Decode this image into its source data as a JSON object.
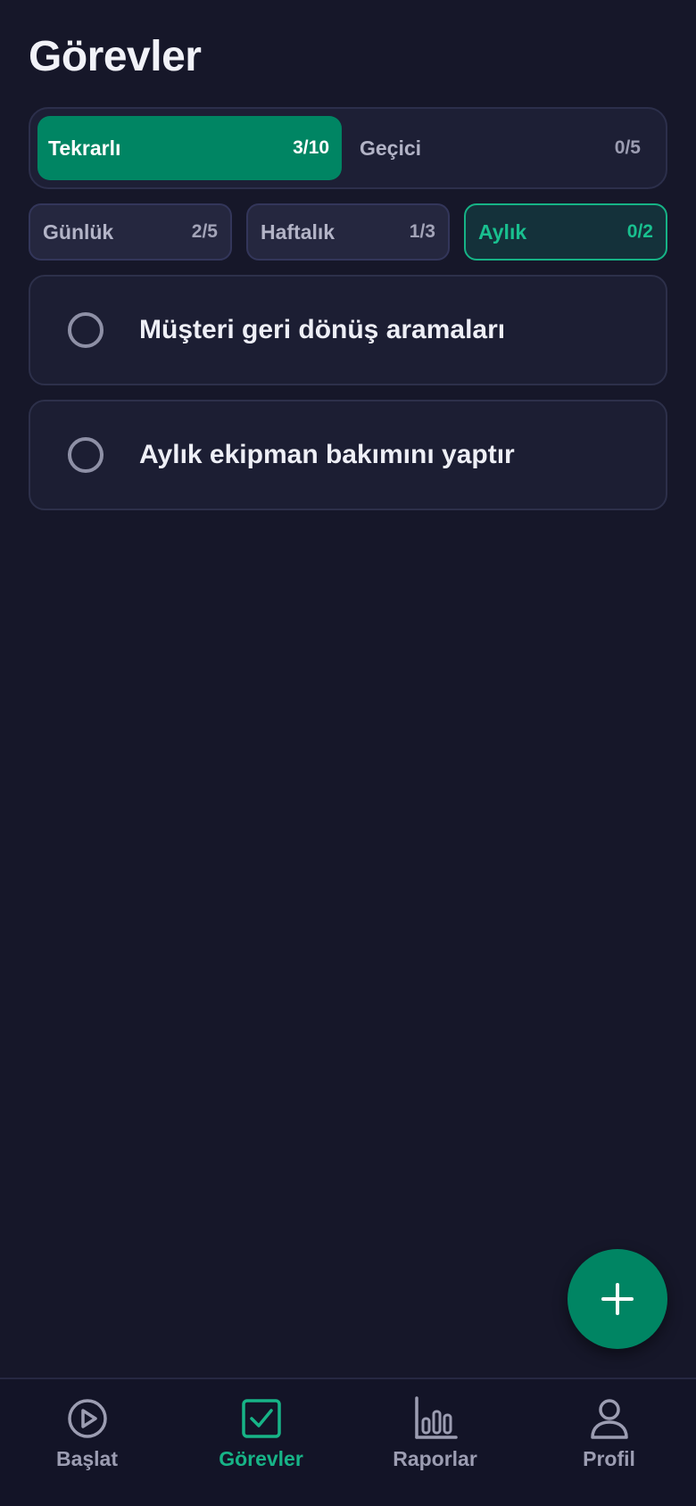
{
  "header": {
    "title": "Görevler"
  },
  "segments": [
    {
      "label": "Tekrarlı",
      "count": "3/10",
      "active": true
    },
    {
      "label": "Geçici",
      "count": "0/5",
      "active": false
    }
  ],
  "periods": [
    {
      "label": "Günlük",
      "count": "2/5",
      "selected": false
    },
    {
      "label": "Haftalık",
      "count": "1/3",
      "selected": false
    },
    {
      "label": "Aylık",
      "count": "0/2",
      "selected": true
    }
  ],
  "tasks": [
    {
      "title": "Müşteri geri dönüş aramaları",
      "done": false
    },
    {
      "title": "Aylık ekipman bakımını yaptır",
      "done": false
    }
  ],
  "fab": {
    "icon": "plus-icon"
  },
  "nav": [
    {
      "label": "Başlat",
      "icon": "play-circle-icon",
      "active": false
    },
    {
      "label": "Görevler",
      "icon": "checkbox-icon",
      "active": true
    },
    {
      "label": "Raporlar",
      "icon": "bar-chart-icon",
      "active": false
    },
    {
      "label": "Profil",
      "icon": "user-icon",
      "active": false
    }
  ],
  "colors": {
    "background": "#161729",
    "accent": "#008563",
    "accent_text": "#17b487",
    "card": "#1c1e33"
  }
}
